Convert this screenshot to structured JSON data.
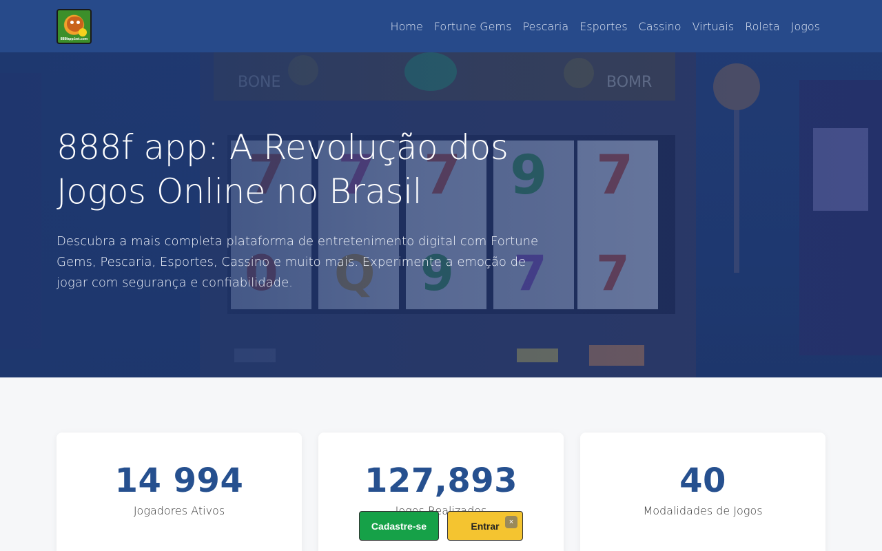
{
  "header": {
    "logo_text": "888fapp.bet.com",
    "nav": [
      "Home",
      "Fortune Gems",
      "Pescaria",
      "Esportes",
      "Cassino",
      "Virtuais",
      "Roleta",
      "Jogos"
    ]
  },
  "hero": {
    "title": "888f app: A Revolução dos Jogos Online no Brasil",
    "description": "Descubra a mais completa plataforma de entretenimento digital com Fortune Gems, Pescaria, Esportes, Cassino e muito mais. Experimente a emoção de jogar com segurança e confiabilidade.",
    "background_image": "slot-machine"
  },
  "stats": [
    {
      "value": "14 994",
      "label": "Jogadores Ativos"
    },
    {
      "value": "127,893",
      "label": "Jogos Realizados"
    },
    {
      "value": "40",
      "label": "Modalidades de Jogos"
    }
  ],
  "cta": {
    "signup_label": "Cadastre-se",
    "login_label": "Entrar",
    "close_symbol": "×"
  },
  "colors": {
    "header_bg": "#274a8a",
    "stat_value": "#26508f",
    "signup_bg": "#16a148",
    "login_bg": "#f4c430"
  }
}
